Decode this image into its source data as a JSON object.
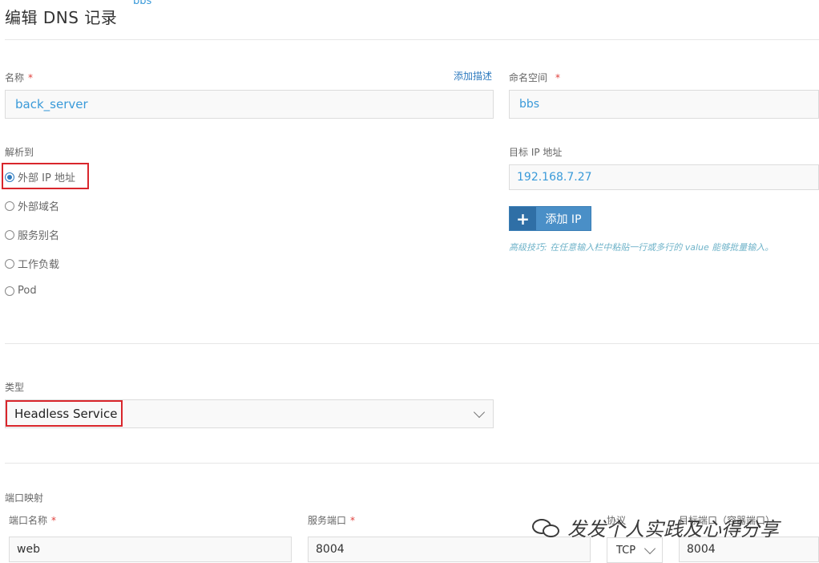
{
  "page": {
    "title": "编辑 DNS 记录",
    "badge": "bbs"
  },
  "name_field": {
    "label": "名称",
    "required_mark": "*",
    "add_description_link": "添加描述",
    "value": "back_server"
  },
  "namespace_field": {
    "label": "命名空间",
    "required_mark": "*",
    "value": "bbs"
  },
  "resolve_to": {
    "label": "解析到",
    "options": [
      {
        "label": "外部 IP 地址",
        "checked": true
      },
      {
        "label": "外部域名",
        "checked": false
      },
      {
        "label": "服务别名",
        "checked": false
      },
      {
        "label": "工作负载",
        "checked": false
      },
      {
        "label": "Pod",
        "checked": false
      }
    ]
  },
  "target_ip": {
    "label": "目标 IP 地址",
    "value": "192.168.7.27",
    "add_button_icon": "+",
    "add_button_label": "添加 IP",
    "tip": "高级技巧: 在任意输入栏中粘贴一行或多行的 value 能够批量输入。"
  },
  "type_field": {
    "label": "类型",
    "selected": "Headless Service"
  },
  "port_mapping": {
    "section_label": "端口映射",
    "columns": {
      "port_name": "端口名称",
      "service_port": "服务端口",
      "protocol": "协议",
      "target_port": "目标端口（容器端口）"
    },
    "required_mark": "*",
    "rows": [
      {
        "port_name": "web",
        "service_port": "8004",
        "protocol": "TCP",
        "target_port": "8004"
      }
    ]
  },
  "watermark": {
    "text": "发发个人实践及心得分享",
    "icon": "wechat-icon"
  },
  "colors": {
    "link": "#2f7bbf",
    "value_blue": "#3a9ad9",
    "required": "#e0403c",
    "highlight_box": "#d9262c",
    "button": "#4a8fc7"
  }
}
